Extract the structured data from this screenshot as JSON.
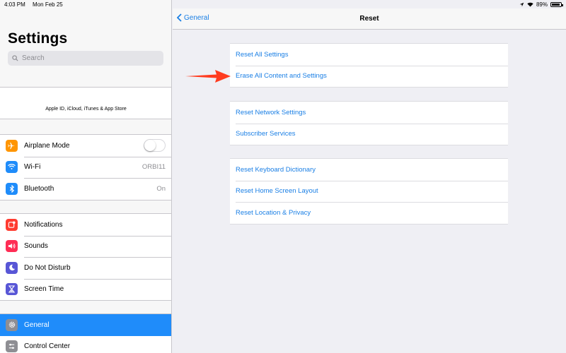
{
  "status": {
    "time": "4:03 PM",
    "date": "Mon Feb 25",
    "battery": "89%",
    "battery_level": 0.89
  },
  "sidebar": {
    "title": "Settings",
    "search_placeholder": "Search",
    "account_label": "Apple ID, iCloud, iTunes & App Store",
    "groups": [
      {
        "items": [
          {
            "label": "Airplane Mode",
            "icon": "airplane-icon",
            "color": "#ff9500",
            "toggle": false
          },
          {
            "label": "Wi-Fi",
            "icon": "wifi-icon",
            "color": "#1f8cfa",
            "value": "ORBI11"
          },
          {
            "label": "Bluetooth",
            "icon": "bluetooth-icon",
            "color": "#1f8cfa",
            "value": "On"
          }
        ]
      },
      {
        "items": [
          {
            "label": "Notifications",
            "icon": "notifications-icon",
            "color": "#ff3b30"
          },
          {
            "label": "Sounds",
            "icon": "sounds-icon",
            "color": "#ff2d55"
          },
          {
            "label": "Do Not Disturb",
            "icon": "moon-icon",
            "color": "#5856d6"
          },
          {
            "label": "Screen Time",
            "icon": "hourglass-icon",
            "color": "#5856d6"
          }
        ]
      },
      {
        "items": [
          {
            "label": "General",
            "icon": "gear-icon",
            "color": "#8e8e93",
            "selected": true
          },
          {
            "label": "Control Center",
            "icon": "control-center-icon",
            "color": "#8e8e93"
          }
        ]
      }
    ]
  },
  "nav": {
    "back_label": "General",
    "title": "Reset"
  },
  "reset": {
    "groups": [
      {
        "items": [
          "Reset All Settings",
          "Erase All Content and Settings"
        ]
      },
      {
        "items": [
          "Reset Network Settings",
          "Subscriber Services"
        ]
      },
      {
        "items": [
          "Reset Keyboard Dictionary",
          "Reset Home Screen Layout",
          "Reset Location & Privacy"
        ]
      }
    ]
  },
  "colors": {
    "accent": "#1a7fe5",
    "selected": "#1f8cfa",
    "annotation_arrow": "#ff3b1f"
  }
}
